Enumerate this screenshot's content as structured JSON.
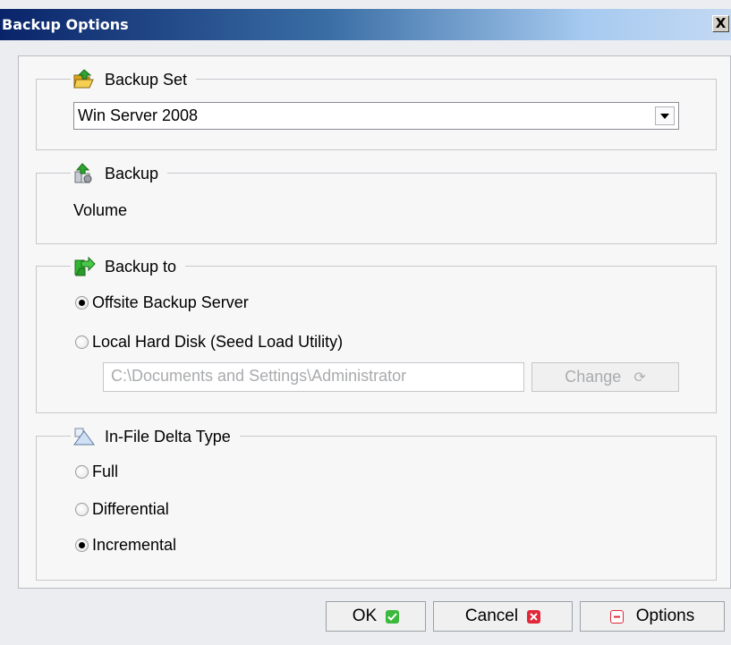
{
  "window": {
    "title": "Backup Options",
    "close_label": "X"
  },
  "backup_set": {
    "legend": "Backup Set",
    "icon": "folder-open-icon",
    "selected": "Win Server 2008"
  },
  "backup": {
    "legend": "Backup",
    "icon": "backup-files-icon",
    "value": "Volume"
  },
  "backup_to": {
    "legend": "Backup to",
    "icon": "green-arrow-icon",
    "options": [
      {
        "label": "Offsite Backup Server",
        "checked": true
      },
      {
        "label": "Local Hard Disk (Seed Load Utility)",
        "checked": false
      }
    ],
    "path_value": "C:\\Documents and Settings\\Administrator",
    "change_label": "Change"
  },
  "delta_type": {
    "legend": "In-File Delta Type",
    "icon": "delta-icon",
    "options": [
      {
        "label": "Full",
        "checked": false
      },
      {
        "label": "Differential",
        "checked": false
      },
      {
        "label": "Incremental",
        "checked": true
      }
    ]
  },
  "buttons": {
    "ok_label": "OK",
    "cancel_label": "Cancel",
    "options_label": "Options"
  },
  "colors": {
    "title_gradient_start": "#0a246a",
    "title_gradient_end": "#a6caf0",
    "ok_icon": "#3cb93c",
    "cancel_icon": "#e0283a",
    "options_icon": "#e0283a"
  }
}
